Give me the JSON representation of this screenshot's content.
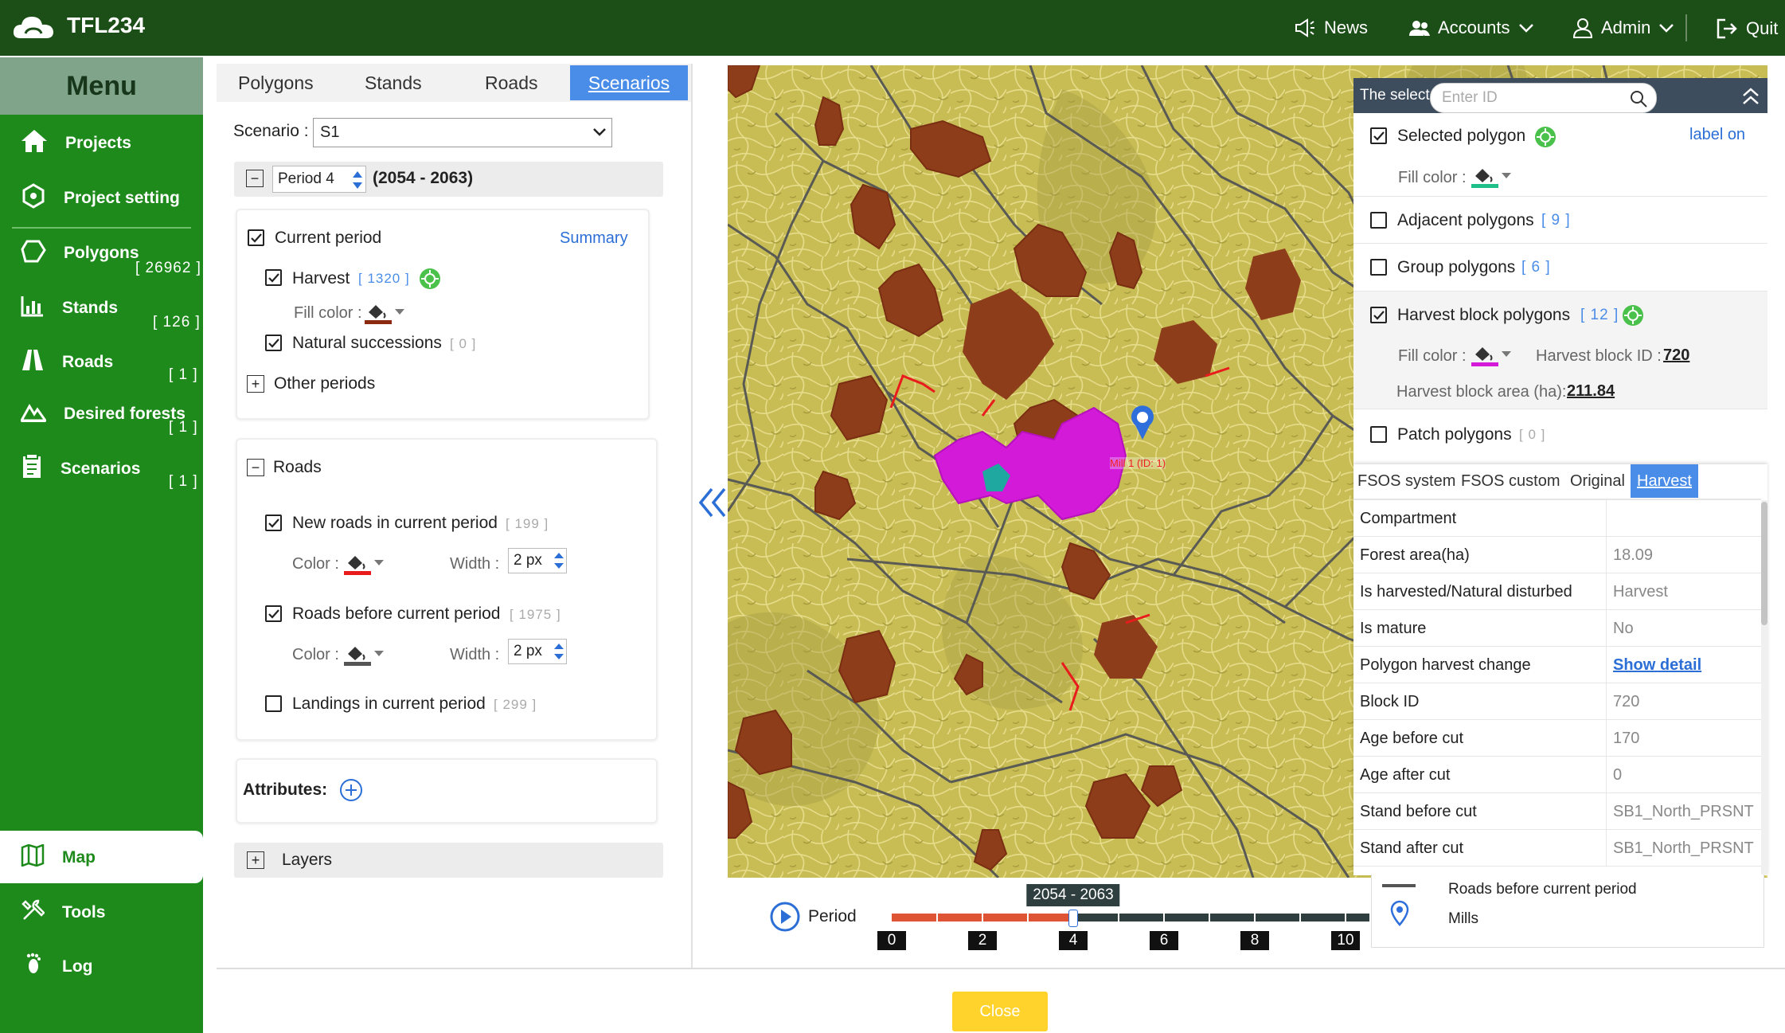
{
  "app": {
    "title": "TFL234"
  },
  "topnav": {
    "news": "News",
    "accounts": "Accounts",
    "admin": "Admin",
    "quit": "Quit"
  },
  "sidebar": {
    "menu_title": "Menu",
    "items": [
      {
        "label": "Projects",
        "count": ""
      },
      {
        "label": "Project setting",
        "count": ""
      },
      {
        "label": "Polygons",
        "count": "[ 26962 ]"
      },
      {
        "label": "Stands",
        "count": "[ 126 ]"
      },
      {
        "label": "Roads",
        "count": "[ 1 ]"
      },
      {
        "label": "Desired forests",
        "count": "[ 1 ]"
      },
      {
        "label": "Scenarios",
        "count": "[ 1 ]"
      }
    ],
    "bottom": [
      {
        "label": "Map"
      },
      {
        "label": "Tools"
      },
      {
        "label": "Log"
      }
    ]
  },
  "panel": {
    "tabs": [
      "Polygons",
      "Stands",
      "Roads",
      "Scenarios"
    ],
    "scenario_label": "Scenario :",
    "scenario_value": "S1",
    "period_label": "Period 4",
    "period_range": "(2054 - 2063)",
    "current_period": {
      "label": "Current period",
      "summary": "Summary",
      "harvest_label": "Harvest",
      "harvest_count": "[ 1320 ]",
      "fill_color_label": "Fill color :",
      "natural_label": "Natural successions",
      "natural_count": "[ 0 ]",
      "other_periods": "Other periods"
    },
    "roads": {
      "title": "Roads",
      "new_roads_label": "New roads in current period",
      "new_roads_count": "[ 199 ]",
      "color_label": "Color :",
      "width_label": "Width :",
      "width_value_1": "2 px",
      "before_label": "Roads before current period",
      "before_count": "[ 1975 ]",
      "width_value_2": "2 px",
      "landings_label": "Landings in current period",
      "landings_count": "[ 299 ]"
    },
    "attributes_label": "Attributes:",
    "layers_label": "Layers"
  },
  "selection": {
    "header": "The select",
    "search_placeholder": "Enter ID",
    "selected_label": "Selected polygon",
    "label_on": "label on",
    "fill_color_label": "Fill color :",
    "adjacent_label": "Adjacent polygons",
    "adjacent_count": "[ 9 ]",
    "group_label": "Group polygons",
    "group_count": "[ 6 ]",
    "harvest_block_label": "Harvest block polygons",
    "harvest_block_count": "[ 12 ]",
    "harvest_block_id_label": "Harvest block ID :",
    "harvest_block_id": "720",
    "harvest_block_area_label": "Harvest block area (ha):",
    "harvest_block_area": "211.84",
    "patch_label": "Patch polygons",
    "patch_count": "[ 0 ]"
  },
  "property_tabs": [
    "FSOS system",
    "FSOS custom",
    "Original",
    "Harvest"
  ],
  "properties": [
    {
      "key": "Compartment",
      "value": ""
    },
    {
      "key": "Forest area(ha)",
      "value": "18.09"
    },
    {
      "key": "Is harvested/Natural disturbed",
      "value": "Harvest"
    },
    {
      "key": "Is mature",
      "value": "No"
    },
    {
      "key": "Polygon harvest change",
      "value": "Show detail"
    },
    {
      "key": "Block ID",
      "value": "720"
    },
    {
      "key": "Age before cut",
      "value": "170"
    },
    {
      "key": "Age after cut",
      "value": "0"
    },
    {
      "key": "Stand before cut",
      "value": "SB1_North_PRSNT"
    },
    {
      "key": "Stand after cut",
      "value": "SB1_North_PRSNT"
    }
  ],
  "legend": {
    "roads_before": "Roads before current period",
    "mills": "Mills"
  },
  "map": {
    "mill_label": "Mill 1 (ID: 1)"
  },
  "timeline": {
    "label": "Period",
    "current_range": "2054 - 2063",
    "current_period": 4,
    "max_period": 11,
    "ticks": [
      "0",
      "2",
      "4",
      "6",
      "8",
      "10"
    ]
  },
  "close_label": "Close",
  "colors": {
    "topbar": "#1c4e17",
    "sidebar": "#1f8a1c",
    "accent": "#4a8de8",
    "harvest_fill": "#8b3a1a",
    "selected_fill": "#1fbf8a",
    "block_fill": "#d21ad8",
    "new_road": "#e81c1c",
    "old_road": "#555555",
    "map_bg": "#c9bd56"
  }
}
